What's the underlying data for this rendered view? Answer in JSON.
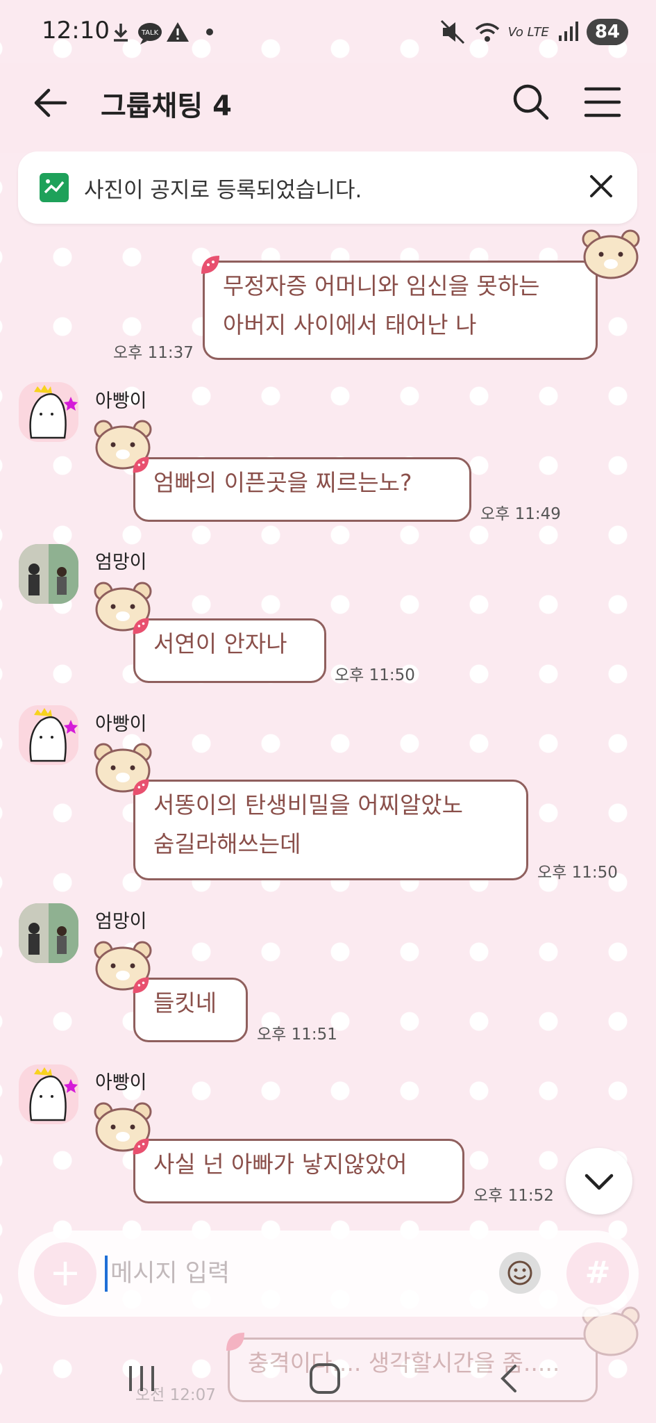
{
  "status_bar": {
    "time": "12:10",
    "talk_badge": "TALK",
    "network": "Vo LTE",
    "battery": "84"
  },
  "header": {
    "title": "그룹채팅 4"
  },
  "notice": {
    "text": "사진이 공지로 등록되었습니다."
  },
  "messages": [
    {
      "sender": "",
      "mine": true,
      "lines": [
        "무정자증 어머니와 임신을 못하는",
        "아버지 사이에서 태어난 나"
      ],
      "time": "오후 11:37"
    },
    {
      "sender": "아빵이",
      "mine": false,
      "lines": [
        "엄빠의 이픈곳을 찌르는노?"
      ],
      "time": "오후 11:49"
    },
    {
      "sender": "엄망이",
      "mine": false,
      "lines": [
        "서연이 안자나"
      ],
      "time": "오후 11:50"
    },
    {
      "sender": "아빵이",
      "mine": false,
      "lines": [
        "서똥이의 탄생비밀을 어찌알았노",
        "숨길라해쓰는데"
      ],
      "time": "오후 11:50"
    },
    {
      "sender": "엄망이",
      "mine": false,
      "lines": [
        "들킷네"
      ],
      "time": "오후 11:51"
    },
    {
      "sender": "아빵이",
      "mine": false,
      "lines": [
        "사실 넌 아빠가 낳지않았어"
      ],
      "time": "오후 11:52"
    },
    {
      "sender": "",
      "mine": true,
      "lines": [
        "충격이다.... 생각할시간을 좀....."
      ],
      "time": "오전 12:07"
    }
  ],
  "input": {
    "placeholder": "메시지 입력"
  },
  "colors": {
    "background": "#fbeaf0",
    "bubble_border": "#8f5f5d",
    "bubble_text": "#8a4f4a",
    "notice_icon": "#1ea15a"
  }
}
